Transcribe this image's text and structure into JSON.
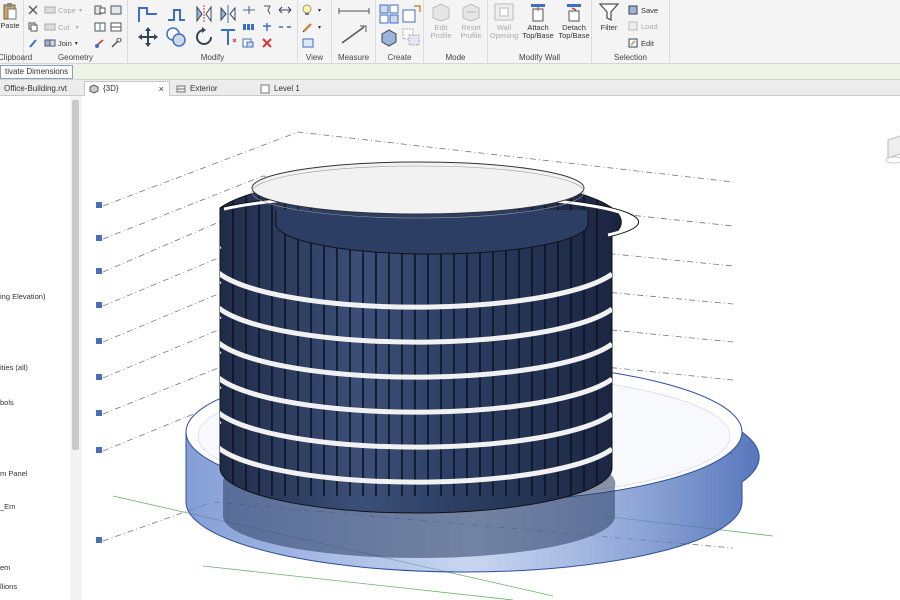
{
  "ribbon": {
    "clipboard": {
      "paste": "Paste",
      "label": "Clipboard"
    },
    "geometry": {
      "cope": "Cope",
      "cut": "Cut",
      "join": "Join",
      "label": "Geometry"
    },
    "modify": {
      "label": "Modify"
    },
    "view": {
      "label": "View"
    },
    "measure": {
      "label": "Measure"
    },
    "create": {
      "label": "Create"
    },
    "mode": {
      "edit_profile": "Edit Profile",
      "reset_profile": "Reset Profile",
      "label": "Mode"
    },
    "modify_wall": {
      "wall_opening": "Wall Opening",
      "attach": "Attach Top/Base",
      "detach": "Detach Top/Base",
      "label": "Modify Wall"
    },
    "selection": {
      "filter": "Filter",
      "save": "Save",
      "load": "Load",
      "edit": "Edit",
      "label": "Selection"
    }
  },
  "options": {
    "activate_dimensions": "tivate Dimensions"
  },
  "tabs": [
    {
      "label": "Office-Building.rvt"
    },
    {
      "label": "{3D}",
      "close": "×"
    },
    {
      "label": "Exterior"
    },
    {
      "label": "Level 1"
    }
  ],
  "browser": {
    "items": [
      "ing Elevation)",
      "ities (all)",
      "bols",
      "m Panel",
      "_Em",
      "",
      "em",
      "llions"
    ]
  },
  "colors": {
    "ribbon_bg": "#f4f4f4",
    "options_bg": "#eef3e6",
    "glass": "#2c3e63",
    "slab_blue": "#3a5fb0"
  }
}
